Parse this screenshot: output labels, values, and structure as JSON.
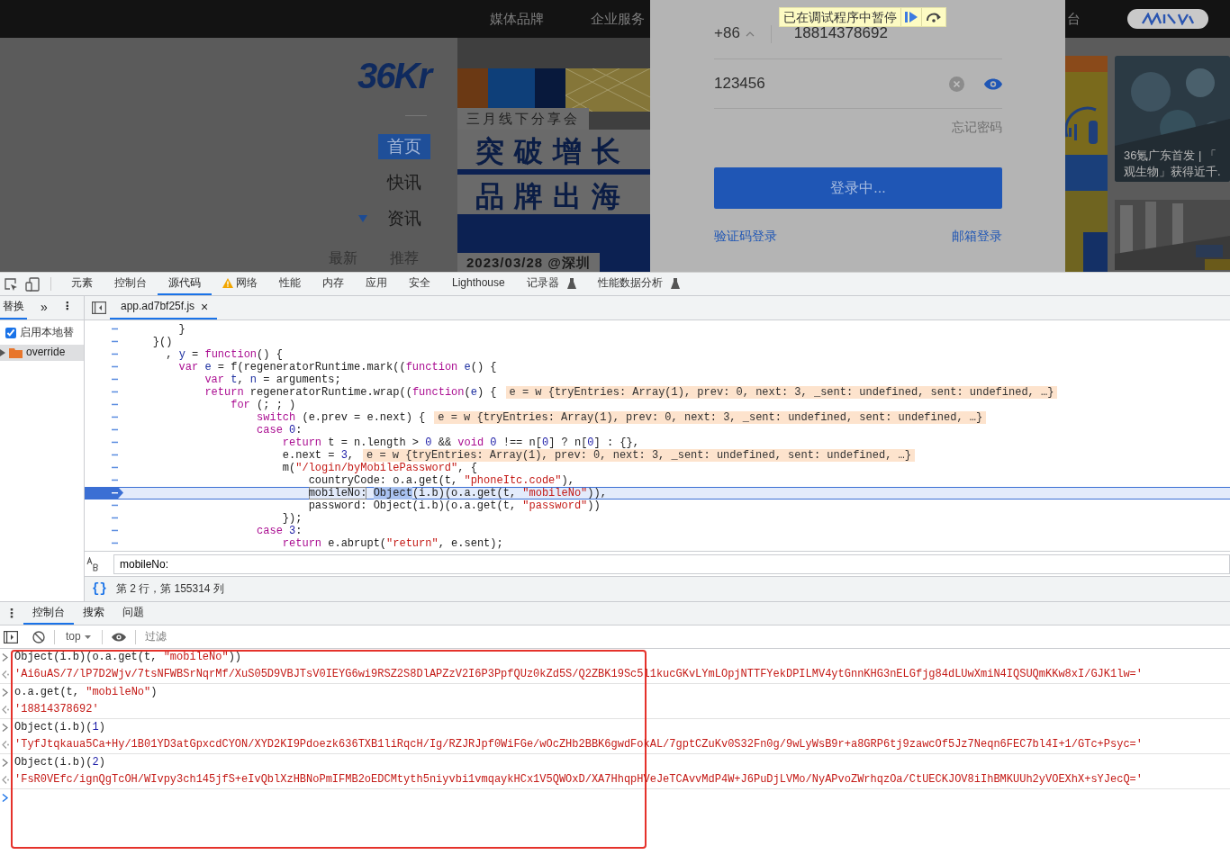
{
  "page": {
    "header_links": [
      "媒体品牌",
      "企业服务"
    ],
    "logo": "36Kr",
    "nav": [
      {
        "label": "首页",
        "selected": true,
        "dropdown": false
      },
      {
        "label": "快讯",
        "selected": false,
        "dropdown": false
      },
      {
        "label": "资讯",
        "selected": false,
        "dropdown": true
      }
    ],
    "subnav": [
      "最新",
      "推荐"
    ],
    "banner": {
      "tagline": "三月线下分享会",
      "headline_1": "突破增长",
      "headline_2": "品牌出海",
      "date": "2023/03/28 @深圳"
    },
    "right_header_text": "台",
    "news_caption": [
      "36氪广东首发 | 「",
      "观生物」获得近千."
    ]
  },
  "login": {
    "paused_banner": "已在调试程序中暂停",
    "country_code": "+86",
    "phone": "18814378692",
    "password": "123456",
    "forgot": "忘记密码",
    "submit": "登录中...",
    "links": [
      "验证码登录",
      "邮箱登录"
    ]
  },
  "devtools": {
    "tabs": [
      {
        "label": "元素",
        "selected": false,
        "warning": false,
        "experimental": false
      },
      {
        "label": "控制台",
        "selected": false,
        "warning": false,
        "experimental": false
      },
      {
        "label": "源代码",
        "selected": true,
        "warning": false,
        "experimental": false
      },
      {
        "label": "网络",
        "selected": false,
        "warning": true,
        "experimental": false
      },
      {
        "label": "性能",
        "selected": false,
        "warning": false,
        "experimental": false
      },
      {
        "label": "内存",
        "selected": false,
        "warning": false,
        "experimental": false
      },
      {
        "label": "应用",
        "selected": false,
        "warning": false,
        "experimental": false
      },
      {
        "label": "安全",
        "selected": false,
        "warning": false,
        "experimental": false
      },
      {
        "label": "Lighthouse",
        "selected": false,
        "warning": false,
        "experimental": false
      },
      {
        "label": "记录器",
        "selected": false,
        "warning": false,
        "experimental": true
      },
      {
        "label": "性能数据分析",
        "selected": false,
        "warning": false,
        "experimental": true
      }
    ],
    "sidebar": {
      "tab": "替换",
      "more": "»",
      "menu": "⋮",
      "enable_overrides": {
        "label": "启用本地替",
        "checked": true
      },
      "folder": "override"
    },
    "file_tab": {
      "label": "app.ad7bf25f.js",
      "close": "×"
    },
    "code_lines": [
      {
        "current": false,
        "segments": [
          {
            "kind": "plain",
            "text": "        }"
          }
        ]
      },
      {
        "current": false,
        "segments": [
          {
            "kind": "plain",
            "text": "    }()"
          }
        ]
      },
      {
        "current": false,
        "segments": [
          {
            "kind": "plain",
            "text": "      , "
          },
          {
            "kind": "variable",
            "text": "y"
          },
          {
            "kind": "plain",
            "text": " = "
          },
          {
            "kind": "keyword",
            "text": "function"
          },
          {
            "kind": "plain",
            "text": "() {"
          }
        ]
      },
      {
        "current": false,
        "segments": [
          {
            "kind": "keyword",
            "text": "        var "
          },
          {
            "kind": "variable",
            "text": "e"
          },
          {
            "kind": "plain",
            "text": " = f(regeneratorRuntime.mark(("
          },
          {
            "kind": "keyword",
            "text": "function "
          },
          {
            "kind": "variable",
            "text": "e"
          },
          {
            "kind": "plain",
            "text": "() {"
          }
        ]
      },
      {
        "current": false,
        "segments": [
          {
            "kind": "keyword",
            "text": "            var "
          },
          {
            "kind": "variable",
            "text": "t"
          },
          {
            "kind": "plain",
            "text": ", "
          },
          {
            "kind": "variable",
            "text": "n"
          },
          {
            "kind": "plain",
            "text": " = arguments;"
          }
        ]
      },
      {
        "current": false,
        "segments": [
          {
            "kind": "keyword",
            "text": "            return"
          },
          {
            "kind": "plain",
            "text": " regeneratorRuntime.wrap(("
          },
          {
            "kind": "keyword",
            "text": "function"
          },
          {
            "kind": "plain",
            "text": "("
          },
          {
            "kind": "variable",
            "text": "e"
          },
          {
            "kind": "plain",
            "text": ") {"
          }
        ],
        "inline_value": "e = w {tryEntries: Array(1), prev: 0, next: 3, _sent: undefined, sent: undefined, …}"
      },
      {
        "current": false,
        "segments": [
          {
            "kind": "keyword",
            "text": "                for"
          },
          {
            "kind": "plain",
            "text": " (; ; )"
          }
        ]
      },
      {
        "current": false,
        "segments": [
          {
            "kind": "keyword",
            "text": "                    switch"
          },
          {
            "kind": "plain",
            "text": " (e.prev = e.next) {"
          }
        ],
        "inline_value": "e = w {tryEntries: Array(1), prev: 0, next: 3, _sent: undefined, sent: undefined, …}"
      },
      {
        "current": false,
        "segments": [
          {
            "kind": "keyword",
            "text": "                    case "
          },
          {
            "kind": "number",
            "text": "0"
          },
          {
            "kind": "plain",
            "text": ":"
          }
        ]
      },
      {
        "current": false,
        "segments": [
          {
            "kind": "keyword",
            "text": "                        return"
          },
          {
            "kind": "plain",
            "text": " t = n.length > "
          },
          {
            "kind": "number",
            "text": "0"
          },
          {
            "kind": "plain",
            "text": " && "
          },
          {
            "kind": "keyword",
            "text": "void "
          },
          {
            "kind": "number",
            "text": "0"
          },
          {
            "kind": "plain",
            "text": " !== n["
          },
          {
            "kind": "number",
            "text": "0"
          },
          {
            "kind": "plain",
            "text": "] ? n["
          },
          {
            "kind": "number",
            "text": "0"
          },
          {
            "kind": "plain",
            "text": "] : {},"
          }
        ]
      },
      {
        "current": false,
        "segments": [
          {
            "kind": "plain",
            "text": "                        e.next = "
          },
          {
            "kind": "number",
            "text": "3"
          },
          {
            "kind": "plain",
            "text": ","
          }
        ],
        "inline_value": "e = w {tryEntries: Array(1), prev: 0, next: 3, _sent: undefined, sent: undefined, …}"
      },
      {
        "current": false,
        "segments": [
          {
            "kind": "plain",
            "text": "                        m("
          },
          {
            "kind": "string",
            "text": "\"/login/byMobilePassword\""
          },
          {
            "kind": "plain",
            "text": ", {"
          }
        ]
      },
      {
        "current": false,
        "segments": [
          {
            "kind": "plain",
            "text": "                            countryCode: o.a.get(t, "
          },
          {
            "kind": "string",
            "text": "\"phoneItc.code\""
          },
          {
            "kind": "plain",
            "text": "),"
          }
        ]
      },
      {
        "current": true,
        "segments": [
          {
            "kind": "match",
            "text": "                            mobileNo:"
          },
          {
            "kind": "selection",
            "text": " Object"
          },
          {
            "kind": "plain",
            "text": "(i.b)(o.a.get(t, "
          },
          {
            "kind": "string",
            "text": "\"mobileNo\""
          },
          {
            "kind": "plain",
            "text": ")),"
          }
        ]
      },
      {
        "current": false,
        "segments": [
          {
            "kind": "plain",
            "text": "                            password: Object(i.b)(o.a.get(t, "
          },
          {
            "kind": "string",
            "text": "\"password\""
          },
          {
            "kind": "plain",
            "text": "))"
          }
        ]
      },
      {
        "current": false,
        "segments": [
          {
            "kind": "plain",
            "text": "                        });"
          }
        ]
      },
      {
        "current": false,
        "segments": [
          {
            "kind": "keyword",
            "text": "                    case "
          },
          {
            "kind": "number",
            "text": "3"
          },
          {
            "kind": "plain",
            "text": ":"
          }
        ]
      },
      {
        "current": false,
        "segments": [
          {
            "kind": "keyword",
            "text": "                        return"
          },
          {
            "kind": "plain",
            "text": " e.abrupt("
          },
          {
            "kind": "string",
            "text": "\"return\""
          },
          {
            "kind": "plain",
            "text": ", e.sent);"
          }
        ]
      }
    ],
    "search": {
      "value": "mobileNo:"
    },
    "status": {
      "format": "{}",
      "position": "第 2 行，第 155314 列"
    },
    "drawer_tabs": [
      {
        "label": "控制台",
        "selected": true
      },
      {
        "label": "搜索",
        "selected": false
      },
      {
        "label": "问题",
        "selected": false
      }
    ],
    "drawer_menu": "⋮",
    "console": {
      "context": "top",
      "filter_placeholder": "过滤",
      "entries": [
        {
          "kind": "input",
          "segments": [
            {
              "kind": "plain",
              "text": "Object(i.b)(o.a.get(t, "
            },
            {
              "kind": "string",
              "text": "\"mobileNo\""
            },
            {
              "kind": "plain",
              "text": "))"
            }
          ]
        },
        {
          "kind": "output",
          "segments": [
            {
              "kind": "string",
              "text": "'Ai6uAS/7/lP7D2Wjv/7tsNFWBSrNqrMf/XuS05D9VBJTsV0IEYG6wi9RSZ2S8DlAPZzV2I6P3PpfQUz0kZd5S/Q2ZBK19Sc5l1kucGKvLYmLOpjNTTFYekDPILMV4ytGnnKHG3nELGfjg84dLUwXmiN4IQSUQmKKw8xI/GJK1lw='"
            }
          ]
        },
        {
          "kind": "input",
          "segments": [
            {
              "kind": "plain",
              "text": "o.a.get(t, "
            },
            {
              "kind": "string",
              "text": "\"mobileNo\""
            },
            {
              "kind": "plain",
              "text": ")"
            }
          ]
        },
        {
          "kind": "output",
          "segments": [
            {
              "kind": "string",
              "text": "'18814378692'"
            }
          ]
        },
        {
          "kind": "input",
          "segments": [
            {
              "kind": "plain",
              "text": "Object(i.b)("
            },
            {
              "kind": "number",
              "text": "1"
            },
            {
              "kind": "plain",
              "text": ")"
            }
          ]
        },
        {
          "kind": "output",
          "segments": [
            {
              "kind": "string",
              "text": "'TyfJtqkaua5Ca+Hy/1B01YD3atGpxcdCYON/XYD2KI9Pdoezk636TXB1liRqcH/Ig/RZJRJpf0WiFGe/wOcZHb2BBK6gwdFokAL/7gptCZuKv0S32Fn0g/9wLyWsB9r+a8GRP6tj9zawcOf5Jz7Neqn6FEC7bl4I+1/GTc+Psyc='"
            }
          ]
        },
        {
          "kind": "input",
          "segments": [
            {
              "kind": "plain",
              "text": "Object(i.b)("
            },
            {
              "kind": "number",
              "text": "2"
            },
            {
              "kind": "plain",
              "text": ")"
            }
          ]
        },
        {
          "kind": "output",
          "segments": [
            {
              "kind": "string",
              "text": "'FsR0VEfc/ignQgTcOH/WIvpy3ch145jfS+eIvQblXzHBNoPmIFMB2oEDCMtyth5niyvbi1vmqaykHCx1V5QWOxD/XA7HhqpHVeJeTCAvvMdP4W+J6PuDjLVMo/NyAPvoZWrhqzOa/CtUECKJOV8iIhBMKUUh2yVOEXhX+sYJecQ='"
            }
          ]
        },
        {
          "kind": "prompt"
        }
      ]
    }
  }
}
